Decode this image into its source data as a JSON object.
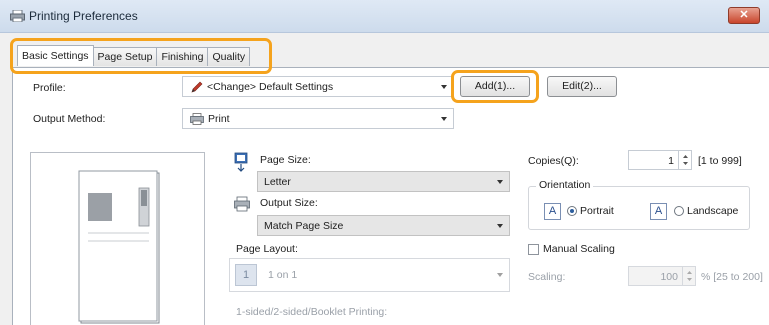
{
  "window": {
    "title": "Printing Preferences",
    "close_glyph": "✕"
  },
  "tabs": [
    {
      "label": "Basic Settings",
      "active": true
    },
    {
      "label": "Page Setup"
    },
    {
      "label": "Finishing"
    },
    {
      "label": "Quality"
    }
  ],
  "profile": {
    "label": "Profile:",
    "value": "<Change> Default Settings",
    "add_button": "Add(1)...",
    "edit_button": "Edit(2)..."
  },
  "output_method": {
    "label": "Output Method:",
    "value": "Print"
  },
  "page_size": {
    "label": "Page Size:",
    "value": "Letter"
  },
  "output_size": {
    "label": "Output Size:",
    "value": "Match Page Size"
  },
  "page_layout": {
    "label": "Page Layout:",
    "icon_number": "1",
    "value": "1 on 1"
  },
  "sided_label": "1-sided/2-sided/Booklet Printing:",
  "copies": {
    "label": "Copies(Q):",
    "value": "1",
    "range": "[1 to 999]"
  },
  "orientation": {
    "label": "Orientation",
    "portrait": "Portrait",
    "landscape": "Landscape",
    "selected": "portrait"
  },
  "scaling": {
    "manual_label": "Manual Scaling",
    "label": "Scaling:",
    "value": "100",
    "range": "% [25 to 200]"
  },
  "colors": {
    "highlight": "#f5a31d",
    "accent": "#2c5e9e"
  }
}
